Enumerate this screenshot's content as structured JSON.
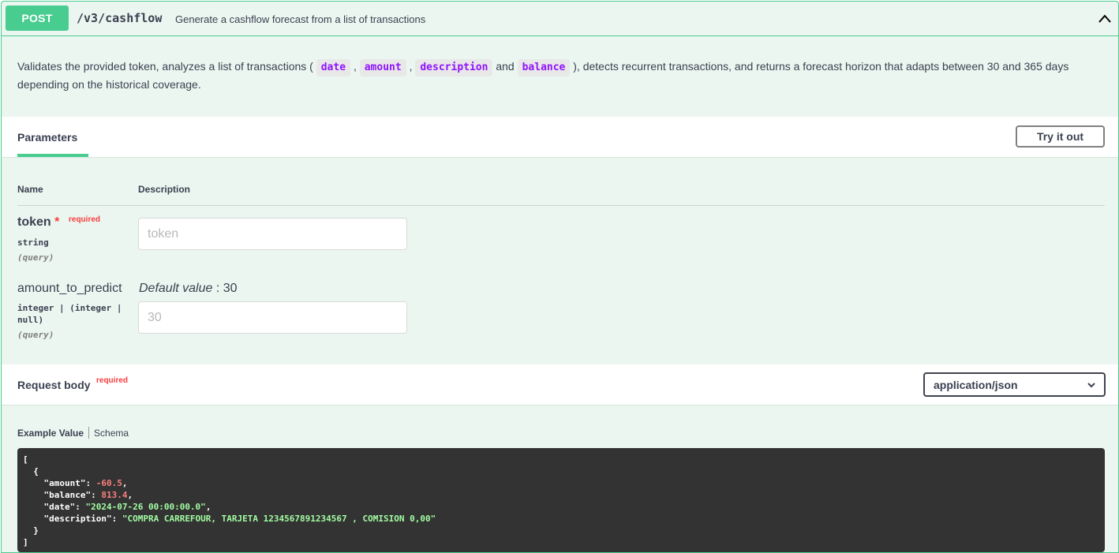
{
  "summary": {
    "method": "POST",
    "path": "/v3/cashflow",
    "description": "Generate a cashflow forecast from a list of transactions"
  },
  "description": {
    "part1": "Validates the provided token, analyzes a list of transactions (",
    "tag_date": "date",
    "sep1": ",",
    "tag_amount": "amount",
    "sep2": ",",
    "tag_description": "description",
    "and": "and",
    "tag_balance": "balance",
    "part2": "), detects recurrent transactions, and returns a forecast horizon that adapts between 30 and 365 days depending on the historical coverage."
  },
  "parameters": {
    "title": "Parameters",
    "try_button": "Try it out",
    "col_name": "Name",
    "col_description": "Description",
    "items": [
      {
        "name": "token",
        "required_star": "*",
        "required_label": "required",
        "type": "string",
        "in": "(query)",
        "placeholder": "token",
        "value": ""
      },
      {
        "name": "amount_to_predict",
        "type_line1": "integer | (integer |",
        "type_line2": "null)",
        "in": "(query)",
        "default_label": "Default value",
        "default_sep": ": 30",
        "placeholder": "30",
        "value": ""
      }
    ]
  },
  "request_body": {
    "title": "Request body",
    "required_label": "required",
    "content_type": "application/json",
    "tab_example": "Example Value",
    "tab_schema": "Schema",
    "example": {
      "open_bracket": "[",
      "open_brace": "  {",
      "amount_key": "    \"amount\": ",
      "amount_val": "-60.5",
      "balance_key": "    \"balance\": ",
      "balance_val": "813.4",
      "date_key": "    \"date\": ",
      "date_val": "\"2024-07-26 00:00:00.0\"",
      "desc_key": "    \"description\": ",
      "desc_val": "\"COMPRA CARREFOUR, TARJETA 1234567891234567 , COMISION 0,00\"",
      "close_brace": "  }",
      "close_bracket": "]",
      "comma": ","
    }
  },
  "colors": {
    "post_green": "#49cc90",
    "post_bg": "#ebf6f0",
    "required_red": "#f93e3e",
    "code_bg": "#333333",
    "tag_purple": "#9012fe"
  },
  "icons": {
    "collapse": "chevron-up-icon",
    "select": "chevron-down-icon"
  }
}
